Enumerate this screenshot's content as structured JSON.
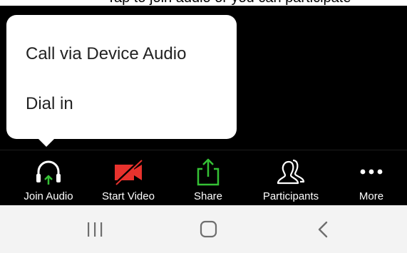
{
  "top_strip": {
    "text": "Tap to join audio   or   you can   participate"
  },
  "audio_menu": {
    "options": [
      "Call via Device Audio",
      "Dial in"
    ]
  },
  "toolbar": {
    "items": [
      {
        "label": "Join Audio",
        "icon": "headphones-arrow-icon"
      },
      {
        "label": "Start Video",
        "icon": "video-camera-off-icon"
      },
      {
        "label": "Share",
        "icon": "share-upload-icon"
      },
      {
        "label": "Participants",
        "icon": "participants-icon"
      },
      {
        "label": "More",
        "icon": "more-dots-icon"
      }
    ]
  },
  "nav_bar": {
    "items": [
      "recents-icon",
      "home-icon",
      "back-icon"
    ]
  },
  "colors": {
    "background": "#000000",
    "video_red": "#e8322d",
    "share_green": "#35c135",
    "arrow_green": "#35c135",
    "nav_bg": "#f3f3f3"
  }
}
